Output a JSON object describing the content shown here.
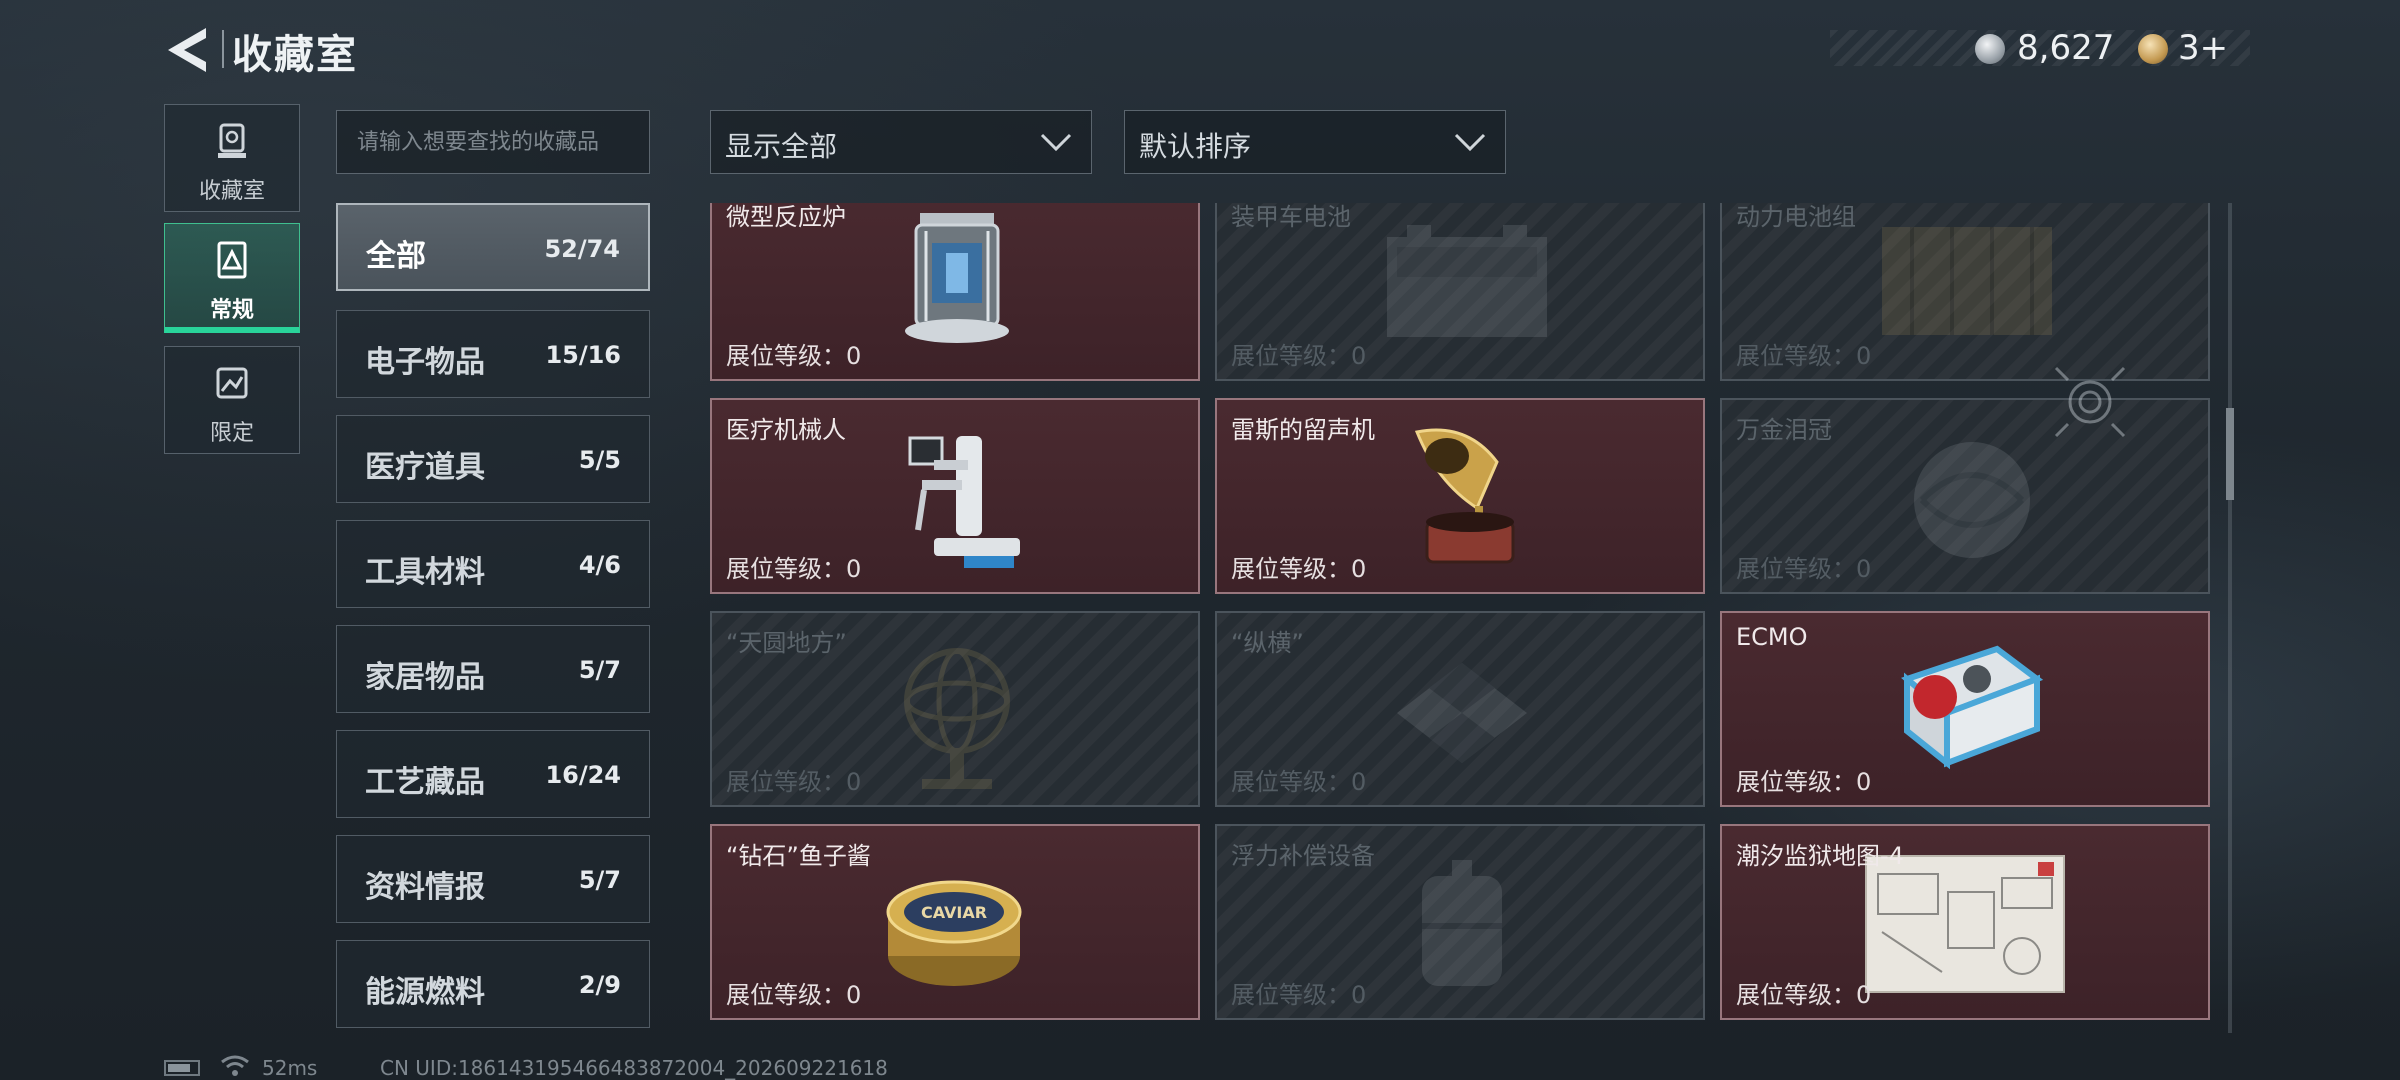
{
  "header": {
    "title": "收藏室",
    "coin_value": "8,627",
    "ticket_value": "3+"
  },
  "mode_nav": [
    {
      "label": "收藏室",
      "icon": "trophy-icon",
      "active": false
    },
    {
      "label": "常规",
      "icon": "regular-collection-icon",
      "active": true
    },
    {
      "label": "限定",
      "icon": "limited-collection-icon",
      "active": false
    }
  ],
  "search": {
    "placeholder": "请输入想要查找的收藏品"
  },
  "filters": {
    "display": "显示全部",
    "sort": "默认排序"
  },
  "categories": [
    {
      "label": "全部",
      "count": "52/74",
      "active": true
    },
    {
      "label": "电子物品",
      "count": "15/16"
    },
    {
      "label": "医疗道具",
      "count": "5/5"
    },
    {
      "label": "工具材料",
      "count": "4/6"
    },
    {
      "label": "家居物品",
      "count": "5/7"
    },
    {
      "label": "工艺藏品",
      "count": "16/24"
    },
    {
      "label": "资料情报",
      "count": "5/7"
    },
    {
      "label": "能源燃料",
      "count": "2/9"
    }
  ],
  "items": [
    {
      "name": "微型反应炉",
      "level_label": "展位等级：",
      "level": "0",
      "owned": true,
      "art": "reactor"
    },
    {
      "name": "装甲车电池",
      "level_label": "展位等级：",
      "level": "0",
      "owned": false,
      "art": "battery"
    },
    {
      "name": "动力电池组",
      "level_label": "展位等级：",
      "level": "0",
      "owned": false,
      "art": "battery-pack"
    },
    {
      "name": "医疗机械人",
      "level_label": "展位等级：",
      "level": "0",
      "owned": true,
      "art": "robot"
    },
    {
      "name": "雷斯的留声机",
      "level_label": "展位等级：",
      "level": "0",
      "owned": true,
      "art": "gramophone"
    },
    {
      "name": "万金泪冠",
      "level_label": "展位等级：",
      "level": "0",
      "owned": false,
      "art": "crown"
    },
    {
      "name": "“天圆地方”",
      "level_label": "展位等级：",
      "level": "0",
      "owned": false,
      "art": "globe"
    },
    {
      "name": "“纵横”",
      "level_label": "展位等级：",
      "level": "0",
      "owned": false,
      "art": "board"
    },
    {
      "name": "ECMO",
      "level_label": "展位等级：",
      "level": "0",
      "owned": true,
      "art": "ecmo"
    },
    {
      "name": "“钻石”鱼子酱",
      "level_label": "展位等级：",
      "level": "0",
      "owned": true,
      "art": "caviar",
      "art_text": "CAVIAR"
    },
    {
      "name": "浮力补偿设备",
      "level_label": "展位等级：",
      "level": "0",
      "owned": false,
      "art": "bcd"
    },
    {
      "name": "潮汐监狱地图-4",
      "level_label": "展位等级：",
      "level": "0",
      "owned": true,
      "art": "map"
    }
  ],
  "status": {
    "ping": "52ms",
    "uid": "CN UID:1861431954664838720​04_202609221618"
  }
}
